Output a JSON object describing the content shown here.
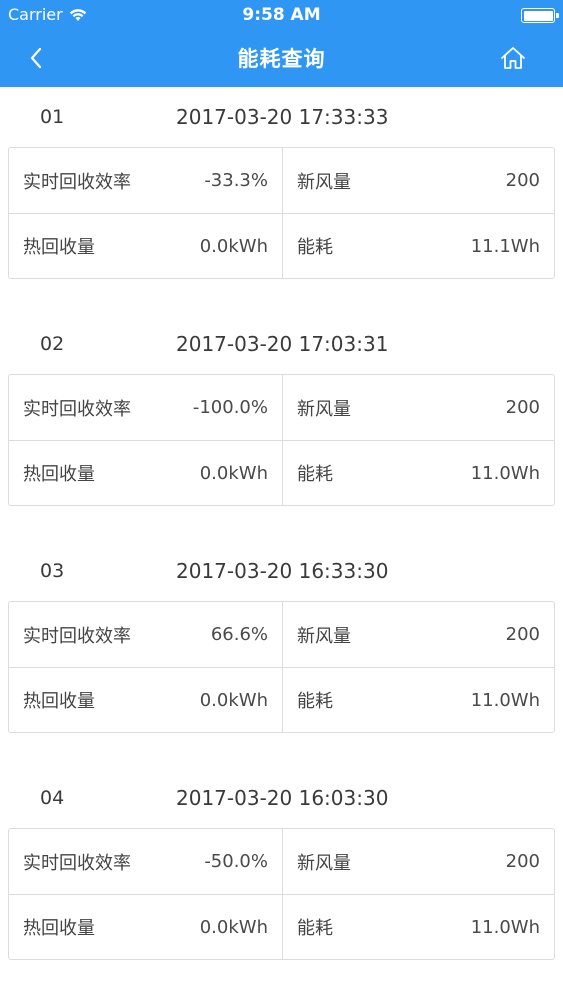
{
  "status_bar": {
    "carrier": "Carrier",
    "time": "9:58 AM"
  },
  "nav": {
    "title": "能耗查询",
    "back_icon": "chevron-left-icon",
    "home_icon": "home-icon"
  },
  "labels": {
    "efficiency": "实时回收效率",
    "fresh_air": "新风量",
    "heat_recovery": "热回收量",
    "energy": "能耗"
  },
  "records": [
    {
      "index": "01",
      "time": "2017-03-20 17:33:33",
      "efficiency": "-33.3%",
      "fresh_air": "200",
      "heat_recovery": "0.0kWh",
      "energy": "11.1Wh"
    },
    {
      "index": "02",
      "time": "2017-03-20 17:03:31",
      "efficiency": "-100.0%",
      "fresh_air": "200",
      "heat_recovery": "0.0kWh",
      "energy": "11.0Wh"
    },
    {
      "index": "03",
      "time": "2017-03-20 16:33:30",
      "efficiency": "66.6%",
      "fresh_air": "200",
      "heat_recovery": "0.0kWh",
      "energy": "11.0Wh"
    },
    {
      "index": "04",
      "time": "2017-03-20 16:03:30",
      "efficiency": "-50.0%",
      "fresh_air": "200",
      "heat_recovery": "0.0kWh",
      "energy": "11.0Wh"
    }
  ],
  "colors": {
    "nav_bg": "#2f97f3",
    "border": "#dcdcdc"
  }
}
